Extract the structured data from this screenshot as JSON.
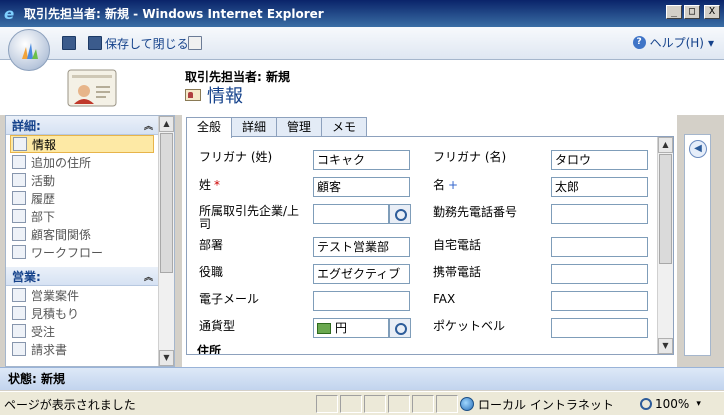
{
  "window": {
    "title": "取引先担当者: 新規 - Windows Internet Explorer",
    "buttons": [
      "_",
      "□",
      "X"
    ]
  },
  "toolbar": {
    "save_close_label": "保存して閉じる",
    "help_label": "ヘルプ(H)",
    "help_caret": "▾"
  },
  "header": {
    "entity_type": "取引先担当者: 新規",
    "form_title": "情報"
  },
  "nav": {
    "sections": [
      {
        "title": "詳細:",
        "items": [
          {
            "label": "情報",
            "icon": "card-icon",
            "active": true
          },
          {
            "label": "追加の住所",
            "icon": "address-icon"
          },
          {
            "label": "活動",
            "icon": "activity-icon"
          },
          {
            "label": "履歴",
            "icon": "history-icon"
          },
          {
            "label": "部下",
            "icon": "subordinate-icon"
          },
          {
            "label": "顧客間関係",
            "icon": "relationship-icon"
          },
          {
            "label": "ワークフロー",
            "icon": "workflow-icon"
          }
        ]
      },
      {
        "title": "営業:",
        "items": [
          {
            "label": "営業案件",
            "icon": "opportunity-icon"
          },
          {
            "label": "見積もり",
            "icon": "quote-icon"
          },
          {
            "label": "受注",
            "icon": "order-icon"
          },
          {
            "label": "請求書",
            "icon": "invoice-icon"
          }
        ]
      }
    ],
    "collapse_glyph": "︽"
  },
  "tabs": [
    {
      "label": "全般",
      "active": true
    },
    {
      "label": "詳細"
    },
    {
      "label": "管理"
    },
    {
      "label": "メモ"
    }
  ],
  "form": {
    "fields": [
      {
        "label": "フリガナ (姓)",
        "value": ""
      },
      {
        "label": "コキャク",
        "value": "コキャク"
      },
      {
        "label": "フリガナ (名)",
        "value": "タロウ"
      },
      {
        "label": "姓",
        "value": "顧客"
      },
      {
        "label": "名",
        "value": "太郎"
      },
      {
        "label": "所属取引先企業/上司",
        "value": ""
      },
      {
        "label": "勤務先電話番号",
        "value": ""
      },
      {
        "label": "部署",
        "value": "テスト営業部"
      },
      {
        "label": "自宅電話",
        "value": ""
      },
      {
        "label": "役職",
        "value": "エグゼクティブ"
      },
      {
        "label": "携帯電話",
        "value": ""
      },
      {
        "label": "電子メール",
        "value": ""
      },
      {
        "label": "FAX",
        "value": ""
      },
      {
        "label": "通貨型",
        "value": "円"
      },
      {
        "label": "ポケットベル",
        "value": ""
      }
    ],
    "required_mark": "*",
    "recommended_mark": "+",
    "section_title": "住所"
  },
  "status": {
    "label": "状態:",
    "value": "新規"
  },
  "iebar": {
    "message": "ページが表示されました",
    "zone": "ローカル イントラネット",
    "zoom": "100%",
    "zoom_caret": "▾"
  },
  "colors": {
    "titlebar": "#0a246a",
    "link": "#15428b",
    "required": "#cc0000",
    "recommended": "#3366cc",
    "active_nav": "#fde9a5"
  }
}
